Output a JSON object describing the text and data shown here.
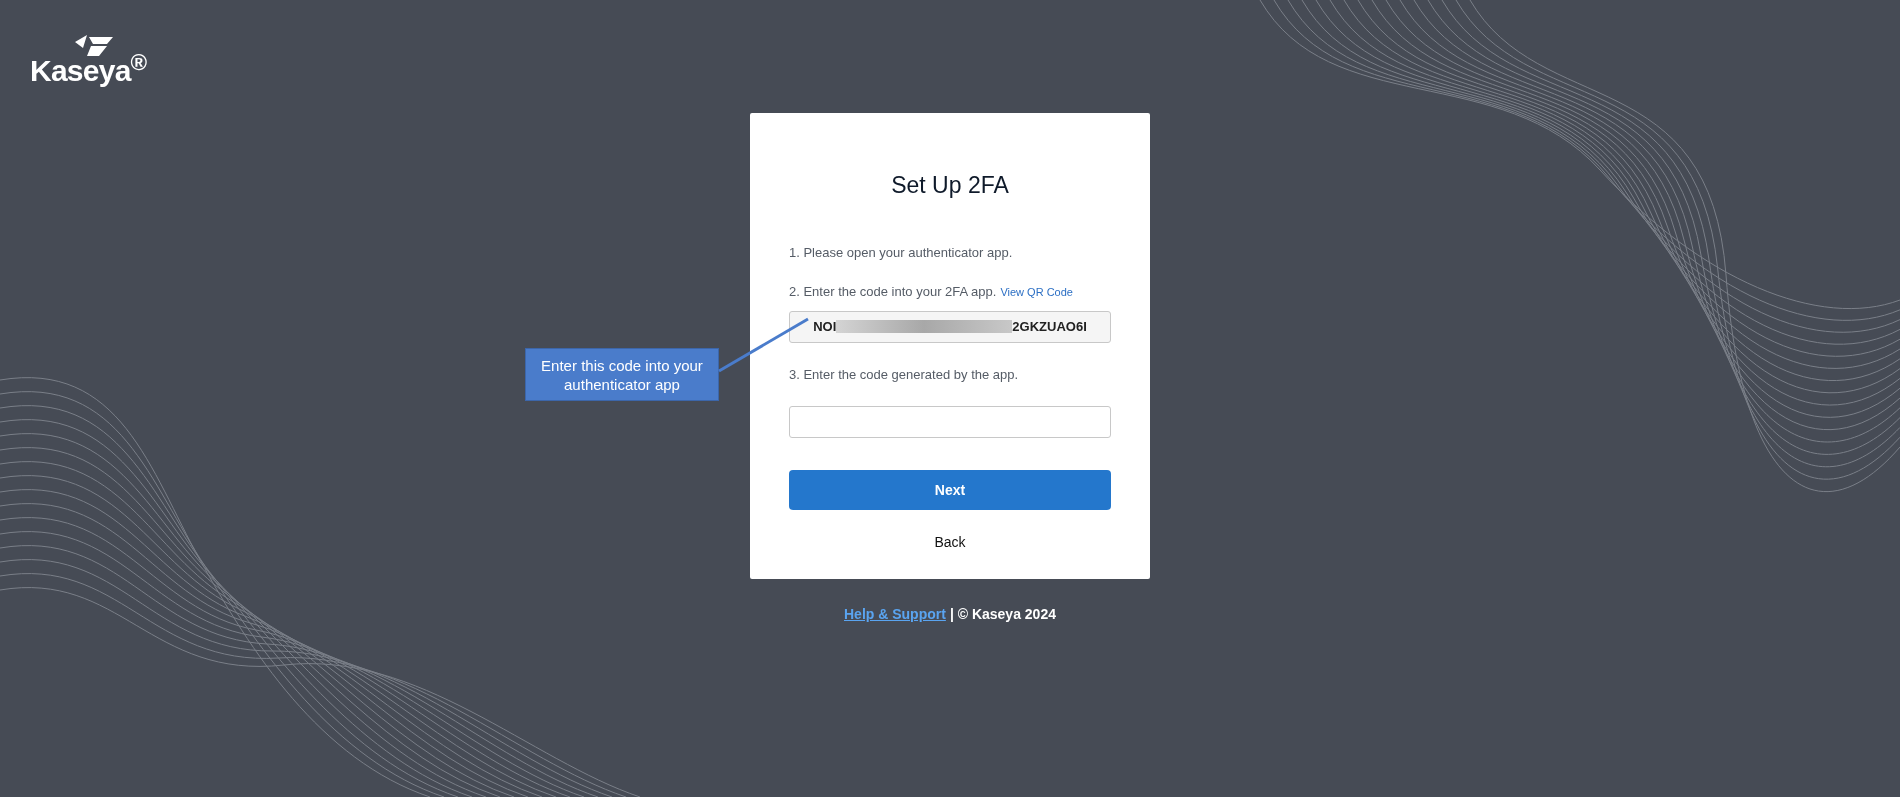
{
  "logo": {
    "text": "Kaseya$^{®}$"
  },
  "card": {
    "title": "Set Up 2FA",
    "steps": [
      {
        "kind": "text",
        "text": "1. Please open your authenticator app."
      },
      {
        "kind": "text_link",
        "text": "2. Enter the code into your 2FA app.",
        "link": "View QR Code"
      },
      {
        "kind": "code",
        "code_start": "NOI",
        "code_end": "2GKZUAO6I"
      },
      {
        "kind": "text",
        "text": "3. Enter the code generated by the app."
      },
      {
        "kind": "input"
      }
    ],
    "primary_button": "Next",
    "secondary_button": "Back"
  },
  "callout": {
    "text": "Enter this code into your authenticator app"
  },
  "footer": {
    "link": "Help & Support",
    "text": "| © Kaseya 2024"
  }
}
